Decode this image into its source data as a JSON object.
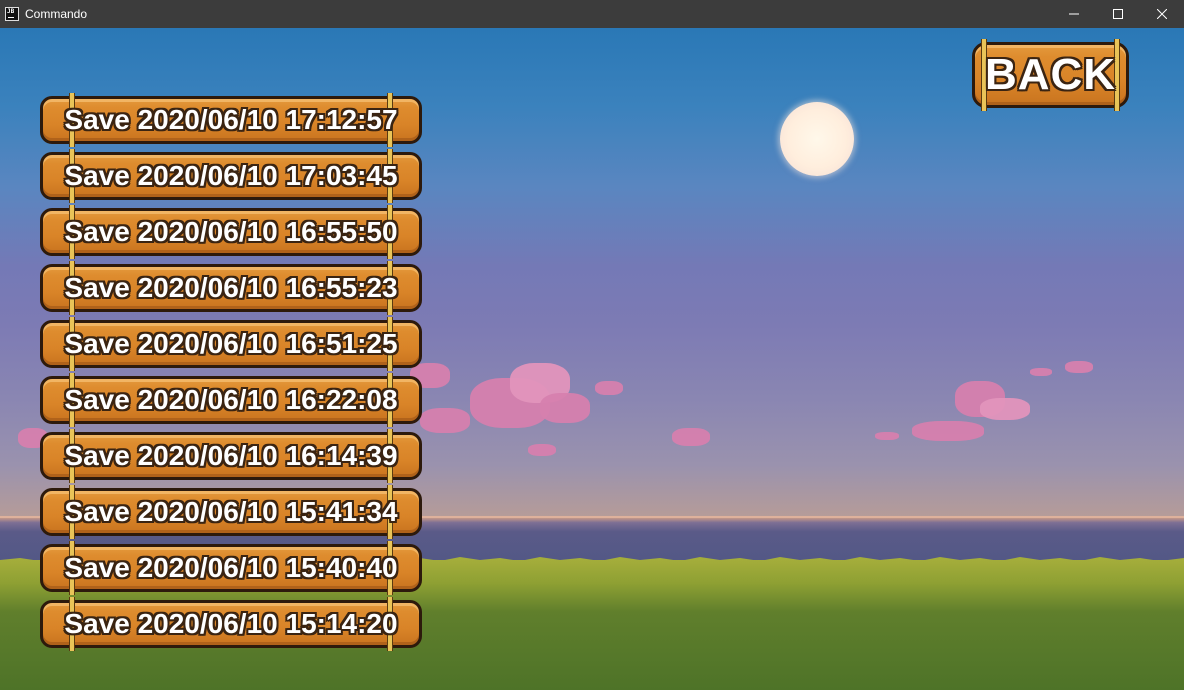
{
  "window": {
    "title": "Commando",
    "icon": "jetbrains-app-icon",
    "icon_text": "JB"
  },
  "menu": {
    "back_label": "BACK",
    "save_slots": [
      {
        "label": "Save 2020/06/10 17:12:57"
      },
      {
        "label": "Save 2020/06/10 17:03:45"
      },
      {
        "label": "Save 2020/06/10 16:55:50"
      },
      {
        "label": "Save 2020/06/10 16:55:23"
      },
      {
        "label": "Save 2020/06/10 16:51:25"
      },
      {
        "label": "Save 2020/06/10 16:22:08"
      },
      {
        "label": "Save 2020/06/10 16:14:39"
      },
      {
        "label": "Save 2020/06/10 15:41:34"
      },
      {
        "label": "Save 2020/06/10 15:40:40"
      },
      {
        "label": "Save 2020/06/10 15:14:20"
      }
    ]
  },
  "colors": {
    "plank": "#d98428",
    "plank_border": "#2d1a0c",
    "sky_top": "#2a78b6",
    "sky_mid": "#7d7bb4",
    "grass": "#607f2c",
    "titlebar": "#3c3c3c"
  }
}
